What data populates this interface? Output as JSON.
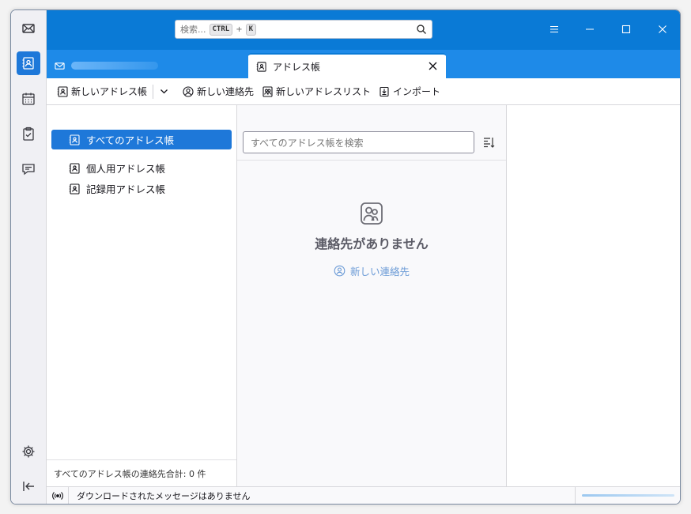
{
  "search": {
    "placeholder": "検索...",
    "key1": "CTRL",
    "plus": "+",
    "key2": "K"
  },
  "tabs": {
    "active_title": "アドレス帳"
  },
  "toolbar": {
    "new_addressbook": "新しいアドレス帳",
    "new_contact": "新しい連絡先",
    "new_list": "新しいアドレスリスト",
    "import": "インポート"
  },
  "books": {
    "items": [
      {
        "label": "すべてのアドレス帳"
      },
      {
        "label": "個人用アドレス帳"
      },
      {
        "label": "記録用アドレス帳"
      }
    ],
    "footer": "すべてのアドレス帳の連絡先合計: 0 件"
  },
  "cards": {
    "search_placeholder": "すべてのアドレス帳を検索",
    "empty_text": "連絡先がありません",
    "empty_link": "新しい連絡先"
  },
  "status": {
    "text": "ダウンロードされたメッセージはありません"
  },
  "colors": {
    "titlebar": "#0a7ad6",
    "tabstrip": "#1e8ae8",
    "accent": "#1e78d9"
  }
}
